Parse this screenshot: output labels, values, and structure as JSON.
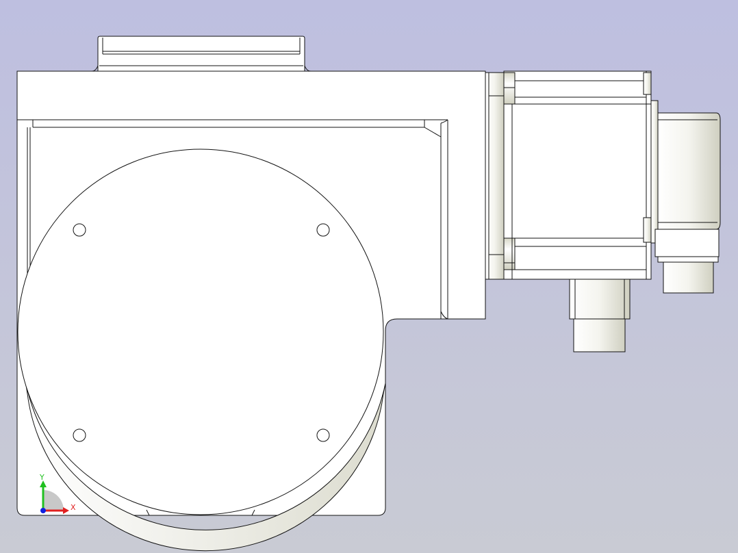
{
  "viewport": {
    "background_top": "#bebfe0",
    "background_bottom": "#c9cbd4"
  },
  "model": {
    "edge_color": "#111111",
    "face_color": "#ffffff",
    "shade_color": "#d9d9cc"
  },
  "triad": {
    "x_label": "X",
    "y_label": "Y",
    "x_color": "#e02020",
    "y_color": "#20c020",
    "z_color": "#1020e0"
  }
}
